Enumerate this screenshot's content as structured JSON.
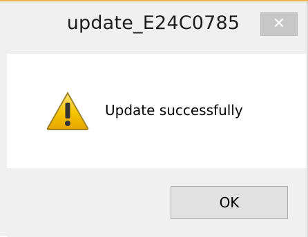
{
  "dialog": {
    "title": "update_E24C0785",
    "close_icon": "close-icon",
    "message": "Update successfully",
    "message_icon": "warning-icon",
    "ok_label": "OK"
  },
  "colors": {
    "title_accent": "#f1b04a",
    "dialog_bg": "#f0f0f0",
    "content_bg": "#ffffff",
    "close_button_bg": "#c7c7c7",
    "ok_button_bg": "#e1e1e1",
    "warning_yellow": "#f6c400",
    "warning_dark": "#333333"
  }
}
